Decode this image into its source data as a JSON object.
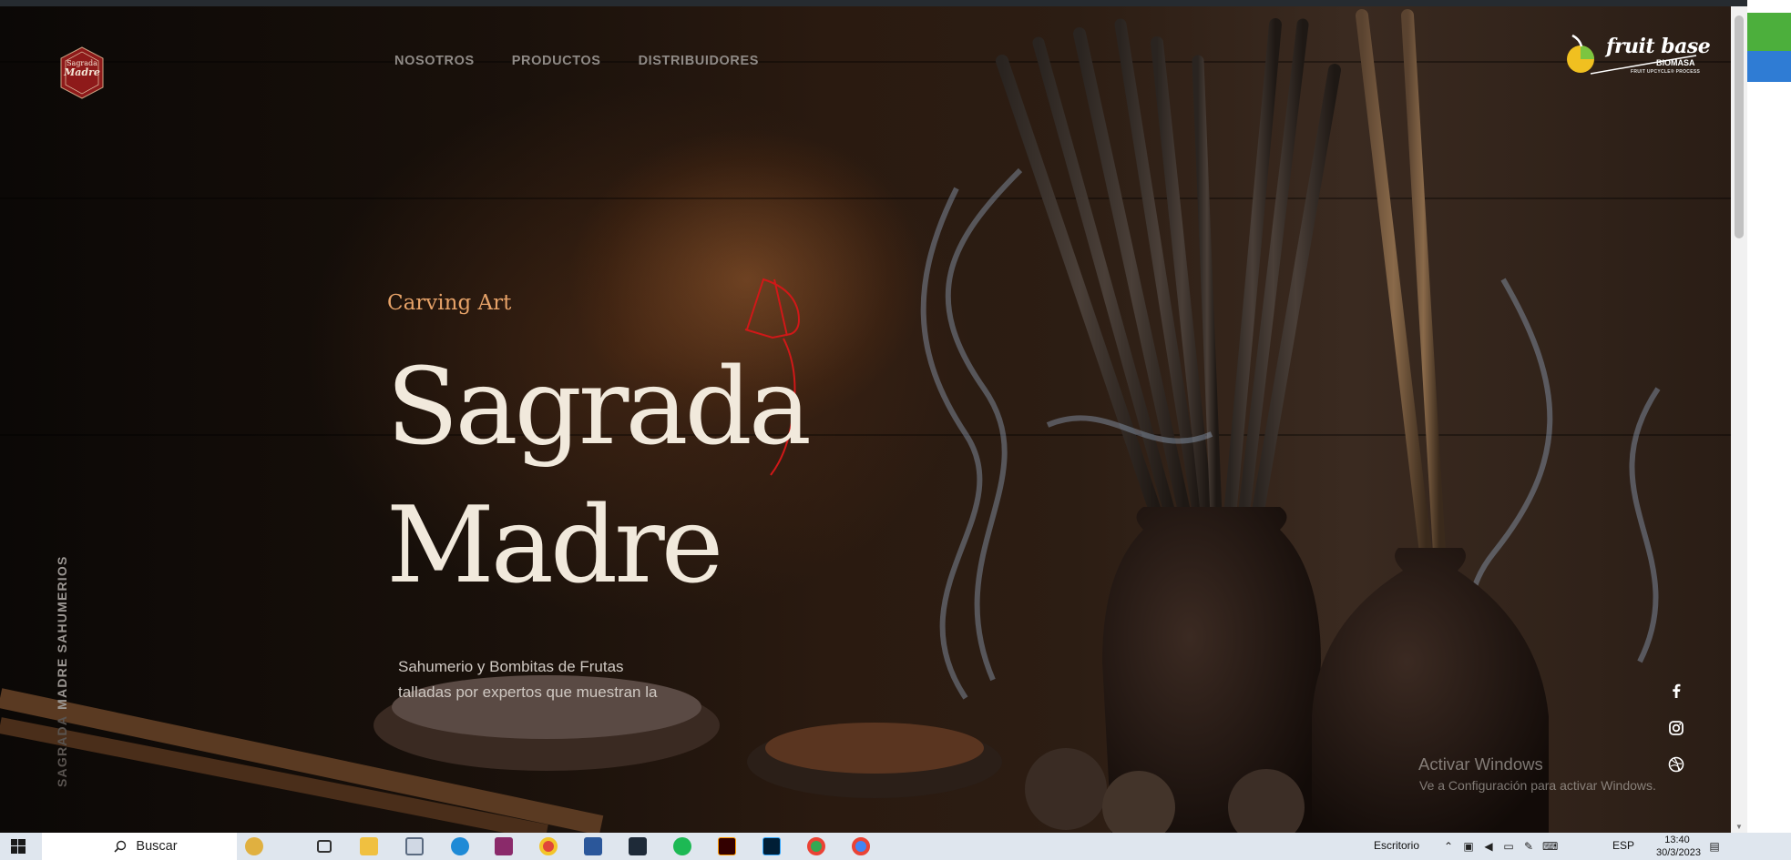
{
  "nav": {
    "items": [
      "NOSOTROS",
      "PRODUCTOS",
      "DISTRIBUIDORES"
    ],
    "logo_text_1": "Sagrada",
    "logo_text_2": "Madre"
  },
  "brand": {
    "name": "fruit base",
    "sub": "BIOMASA",
    "tagline": "FRUIT UPCYCLE® PROCESS"
  },
  "hero": {
    "eyebrow": "Carving Art",
    "title_line1": "Sagrada",
    "title_line2": "Madre",
    "desc_line1": "Sahumerio y Bombitas de Frutas",
    "desc_line2": "talladas por expertos que muestran la"
  },
  "side": {
    "text_a": "SAGRADA",
    "text_b": "MADRE SAHUMERIOS"
  },
  "social": {
    "icons": [
      "facebook-icon",
      "instagram-icon",
      "dribbble-icon"
    ]
  },
  "watermark": {
    "title": "Activar Windows",
    "subtitle": "Ve a Configuración para activar Windows."
  },
  "taskbar": {
    "search_placeholder": "Buscar",
    "desktop_label": "Escritorio",
    "language": "ESP",
    "time": "13:40",
    "date": "30/3/2023"
  },
  "colors": {
    "accent": "#e6a268",
    "title": "#f1e9dc",
    "annotation": "#d01818",
    "logo_red": "#8e1a1a"
  }
}
